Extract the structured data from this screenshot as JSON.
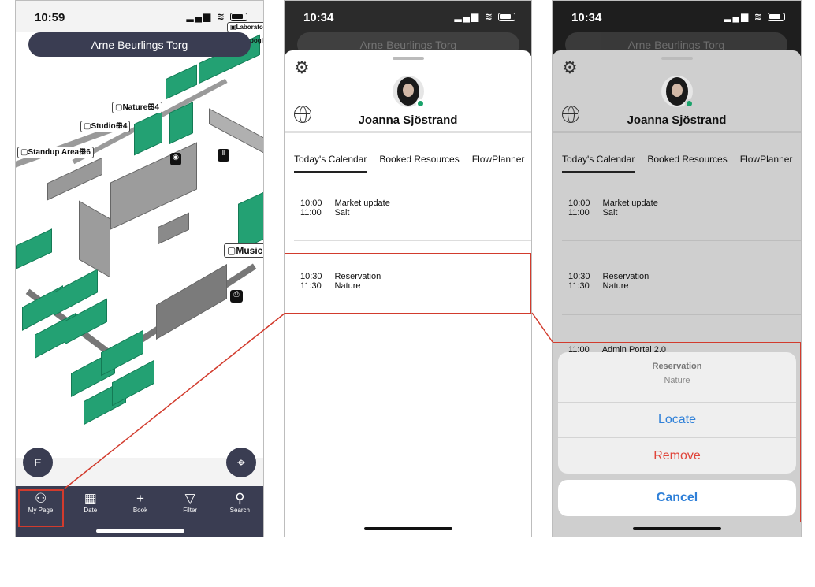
{
  "screen1": {
    "status_time": "10:59",
    "search_title": "Arne Beurlings Torg",
    "rooms": [
      {
        "label": "Nature",
        "count": "4"
      },
      {
        "label": "Studio",
        "count": "4"
      },
      {
        "label": "Standup Area",
        "count": "6"
      },
      {
        "label": "Music",
        "count": ""
      },
      {
        "label": "Laborato",
        "count": ""
      },
      {
        "label": "pogl",
        "count": ""
      }
    ],
    "avatar_initial": "E",
    "tabs": [
      {
        "label": "My Page",
        "icon": "person-icon"
      },
      {
        "label": "Date",
        "icon": "calendar-icon"
      },
      {
        "label": "Book",
        "icon": "plus-icon"
      },
      {
        "label": "Filter",
        "icon": "filter-icon"
      },
      {
        "label": "Search",
        "icon": "search-icon"
      }
    ]
  },
  "screen2": {
    "status_time": "10:34",
    "bg_title": "Arne Beurlings Torg",
    "user_name": "Joanna Sjöstrand",
    "tabs": [
      "Today's Calendar",
      "Booked Resources",
      "FlowPlanner"
    ],
    "entries": [
      {
        "start": "10:00",
        "end": "11:00",
        "title": "Market update",
        "place": "Salt"
      },
      {
        "start": "10:30",
        "end": "11:30",
        "title": "Reservation",
        "place": "Nature"
      }
    ]
  },
  "screen3": {
    "status_time": "10:34",
    "bg_title": "Arne Beurlings Torg",
    "user_name": "Joanna Sjöstrand",
    "tabs": [
      "Today's Calendar",
      "Booked Resources",
      "FlowPlanner"
    ],
    "entries": [
      {
        "start": "10:00",
        "end": "11:00",
        "title": "Market update",
        "place": "Salt"
      },
      {
        "start": "10:30",
        "end": "11:30",
        "title": "Reservation",
        "place": "Nature"
      },
      {
        "start": "11:00",
        "title": "Admin Portal 2.0"
      }
    ],
    "action_sheet": {
      "title": "Reservation",
      "subtitle": "Nature",
      "locate": "Locate",
      "remove": "Remove",
      "cancel": "Cancel"
    }
  },
  "colors": {
    "accent_blue": "#2f80d8",
    "destructive_red": "#e0443a",
    "highlight": "#d23b2d",
    "desk_green": "#23a173",
    "navy": "#3a3d52"
  }
}
